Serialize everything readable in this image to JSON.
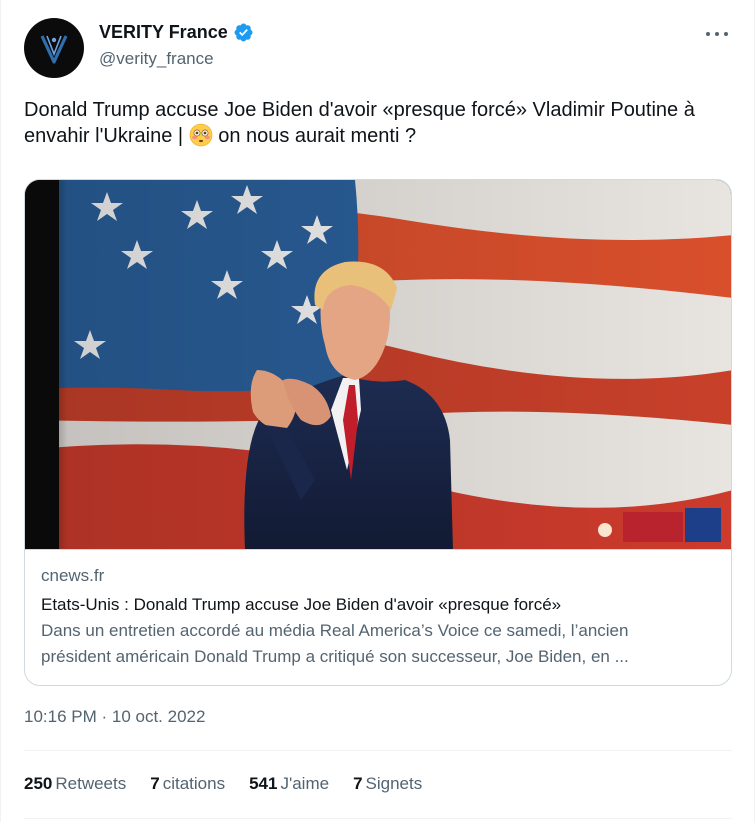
{
  "author": {
    "display_name": "VERITY France",
    "handle": "@verity_france",
    "verified": true
  },
  "tweet": {
    "text_part1": "Donald Trump accuse Joe Biden d'avoir «presque forcé» Vladimir Poutine à envahir l'Ukraine | ",
    "emoji": "flushed-face",
    "text_part2": " on nous aurait menti ?",
    "timestamp": "10:16 PM · 10 oct. 2022"
  },
  "card": {
    "domain": "cnews.fr",
    "title": "Etats-Unis : Donald Trump accuse Joe Biden d'avoir «presque forcé»",
    "description_line1": "Dans un entretien accordé au média Real America’s Voice ce samedi, l’ancien",
    "description_line2": "président américain Donald Trump a critiqué son successeur, Joe Biden, en ..."
  },
  "stats": [
    {
      "count": "250",
      "label": "Retweets"
    },
    {
      "count": "7",
      "label": "citations"
    },
    {
      "count": "541",
      "label": "J'aime"
    },
    {
      "count": "7",
      "label": "Signets"
    }
  ],
  "colors": {
    "text_primary": "#0f1419",
    "text_secondary": "#536471",
    "verified_blue": "#1d9bf0",
    "border": "#cfd9de"
  }
}
